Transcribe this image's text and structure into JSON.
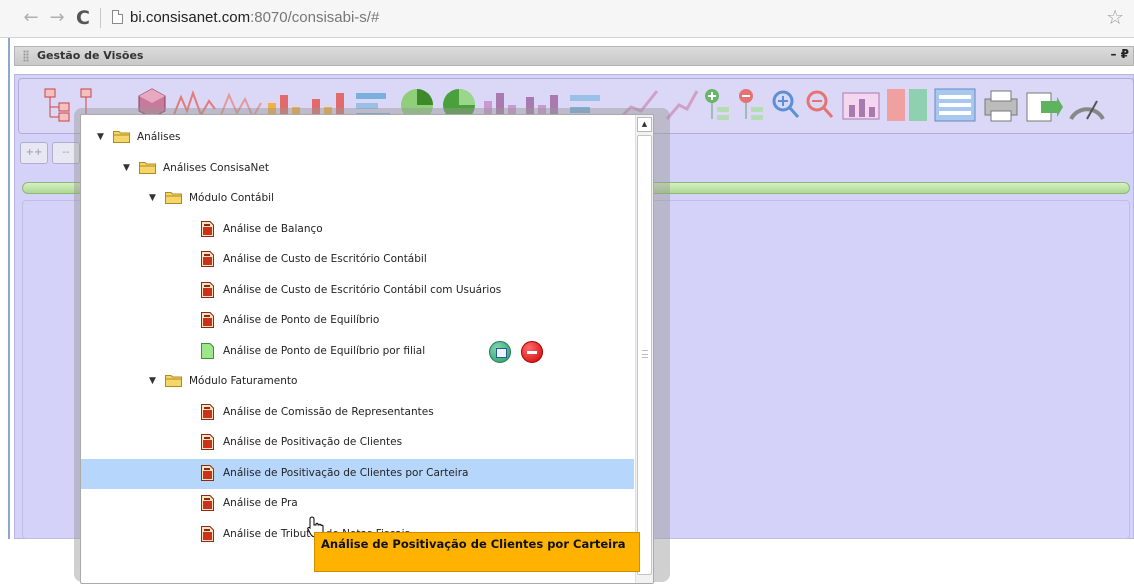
{
  "browser": {
    "url_host": "bi.consisanet.com",
    "url_rest": ":8070/consisabi-s/#"
  },
  "panel": {
    "title": "Gestão de Visões",
    "controls": "– ₽"
  },
  "small_buttons": [
    "++",
    "--"
  ],
  "tree": [
    {
      "type": "folder",
      "label": "Análises",
      "level": 0,
      "expanded": true
    },
    {
      "type": "folder",
      "label": "Análises ConsisaNet",
      "level": 1,
      "expanded": true
    },
    {
      "type": "folder",
      "label": "Módulo Contábil",
      "level": 2,
      "expanded": true
    },
    {
      "type": "doc",
      "label": "Análise de Balanço",
      "level": 3
    },
    {
      "type": "doc",
      "label": "Análise de Custo de Escritório Contábil",
      "level": 3
    },
    {
      "type": "doc",
      "label": "Análise de Custo de Escritório Contábil com Usuários",
      "level": 3
    },
    {
      "type": "doc",
      "label": "Análise de Ponto de Equilíbrio",
      "level": 3
    },
    {
      "type": "doc-new",
      "label": "Análise de Ponto de Equilíbrio por filial",
      "level": 3,
      "actions": true
    },
    {
      "type": "folder",
      "label": "Módulo Faturamento",
      "level": 2,
      "expanded": true
    },
    {
      "type": "doc",
      "label": "Análise de Comissão de Representantes",
      "level": 3
    },
    {
      "type": "doc",
      "label": "Análise de Positivação de Clientes",
      "level": 3
    },
    {
      "type": "doc",
      "label": "Análise de Positivação de Clientes por Carteira",
      "level": 3,
      "selected": true
    },
    {
      "type": "doc",
      "label": "Análise de Pra",
      "level": 3
    },
    {
      "type": "doc",
      "label": "Análise de Tributos de Notas Fiscais",
      "level": 3
    }
  ],
  "tooltip": "Análise de Positivação de Clientes por Carteira",
  "colors": {
    "workspace": "#d4d2f8",
    "selected_row": "#b6d7fb",
    "tooltip": "#ffb300"
  }
}
